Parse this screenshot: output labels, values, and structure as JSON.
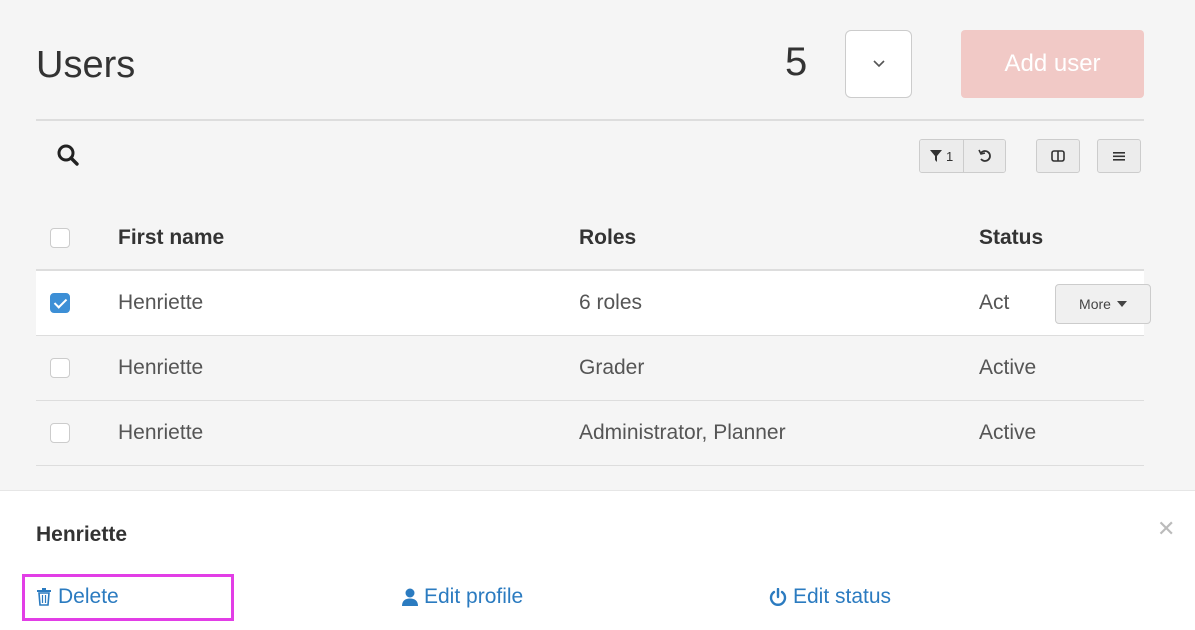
{
  "header": {
    "title": "Users",
    "count": "5",
    "add_user_label": "Add user",
    "accent_disabled": "#f1c9c6"
  },
  "toolbar": {
    "filter_count": "1"
  },
  "table": {
    "columns": [
      "First name",
      "Roles",
      "Status"
    ],
    "rows": [
      {
        "checked": true,
        "first_name": "Henriette",
        "roles": "6 roles",
        "status": "Act",
        "more_label": "More"
      },
      {
        "checked": false,
        "first_name": "Henriette",
        "roles": "Grader",
        "status": "Active"
      },
      {
        "checked": false,
        "first_name": "Henriette",
        "roles": "Administrator, Planner",
        "status": "Active"
      }
    ],
    "selected_row_status_full": "Active"
  },
  "bottom_sheet": {
    "title": "Henriette",
    "actions": {
      "delete": "Delete",
      "edit_profile": "Edit profile",
      "edit_status": "Edit status"
    },
    "link_color": "#2b7bc0",
    "highlight_color": "#e23ee6"
  },
  "icons": {
    "search": "search-icon",
    "filter": "filter-icon",
    "reset": "reset-icon",
    "columns": "columns-icon",
    "menu": "menu-icon",
    "trash": "trash-icon",
    "user": "user-icon",
    "power": "power-icon",
    "close": "close-icon"
  }
}
